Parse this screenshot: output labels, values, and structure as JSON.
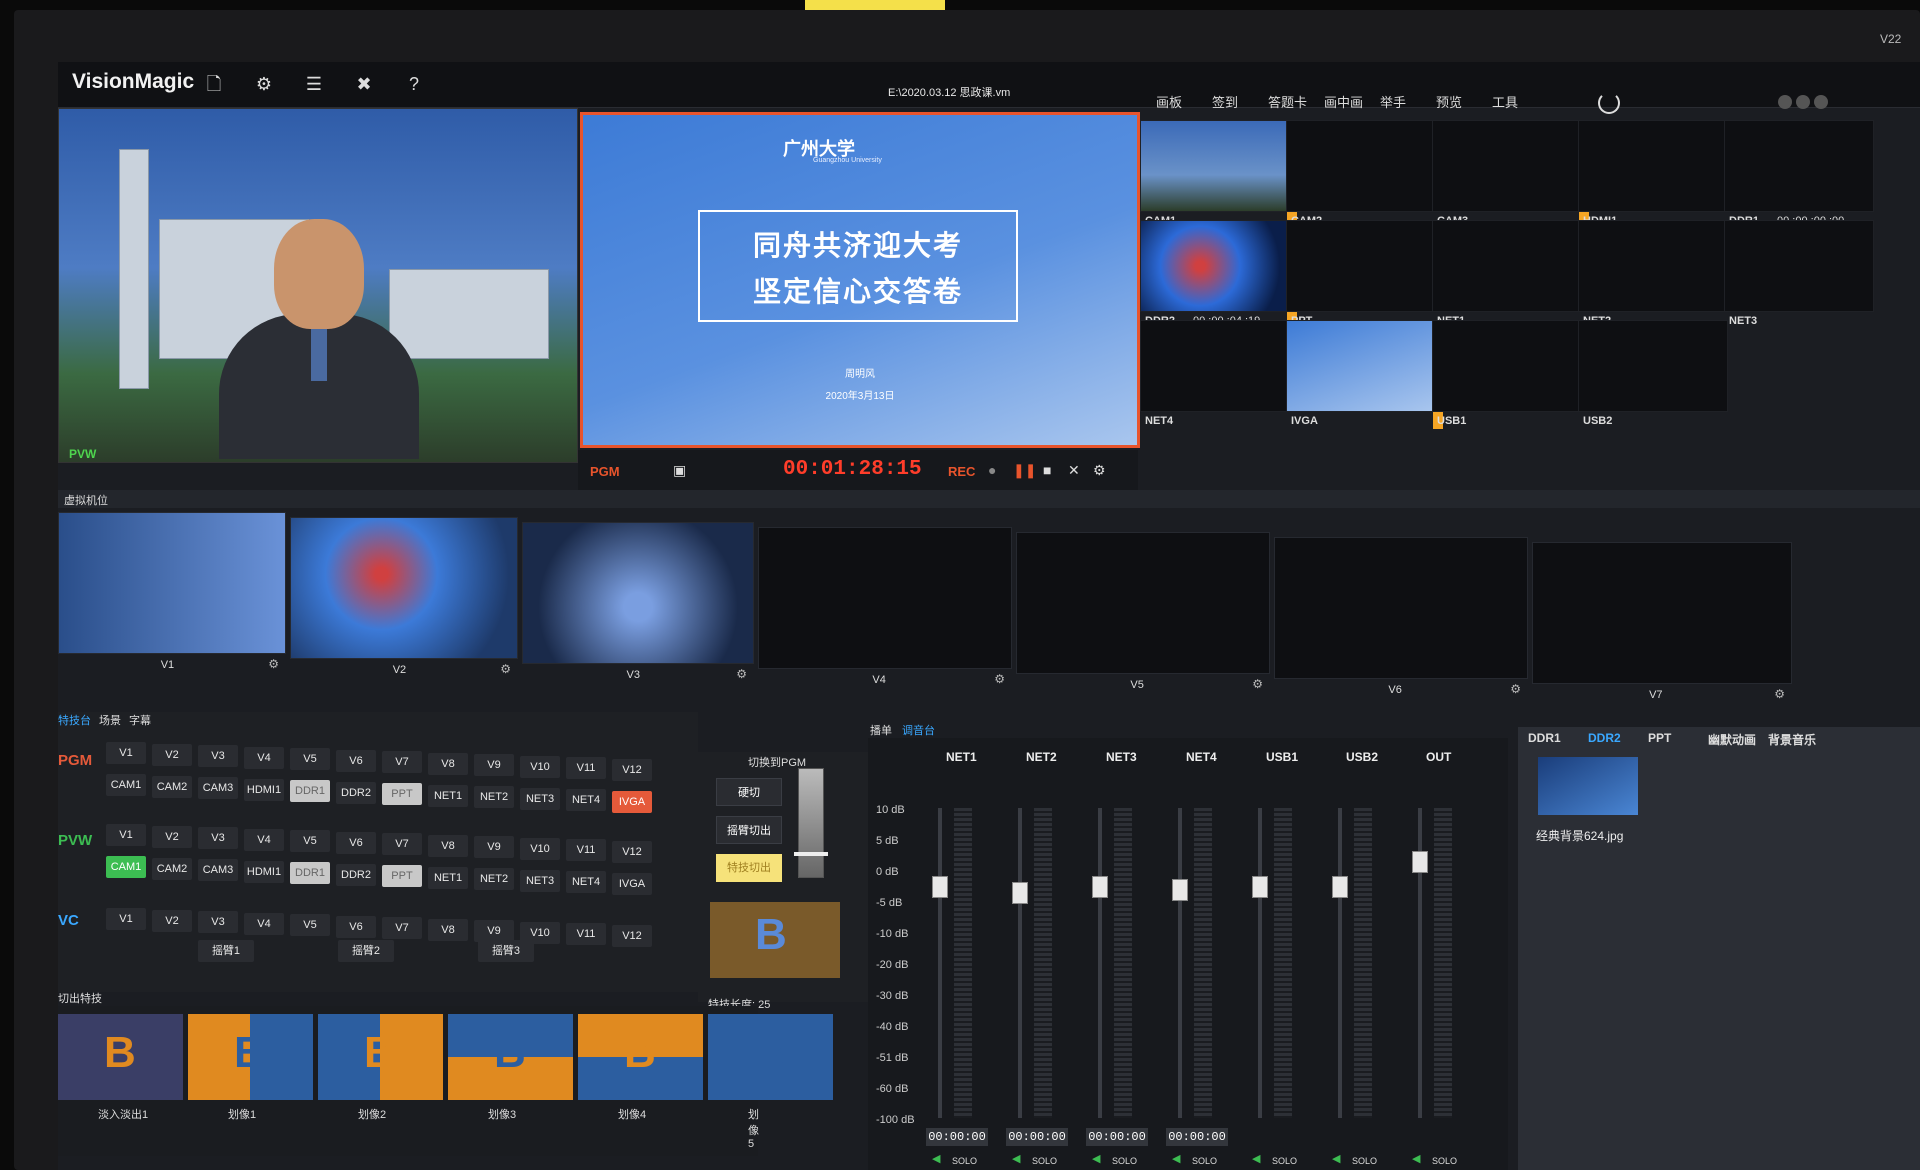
{
  "app": {
    "title": "VisionMagic",
    "filename": "E:\\2020.03.12 思政课.vm",
    "version": "V22"
  },
  "menu": [
    "画板",
    "签到",
    "答题卡",
    "画中画",
    "举手",
    "预览",
    "工具"
  ],
  "pvw_monitor": {
    "label": "PVW"
  },
  "pgm_monitor": {
    "label": "PGM",
    "timer": "00:01:28:15",
    "rec_label": "REC",
    "slide": {
      "university": "广州大学",
      "university_en": "Guangzhou University",
      "line1": "同舟共济迎大考",
      "line2": "坚定信心交答卷",
      "presenter": "周明风",
      "date": "2020年3月13日"
    }
  },
  "sources": [
    {
      "name": "CAM1",
      "active": true
    },
    {
      "name": "CAM2"
    },
    {
      "name": "CAM3",
      "active": true
    },
    {
      "name": "HDMI1"
    },
    {
      "name": "DDR1",
      "timecode": "00 :00 :00 :00"
    },
    {
      "name": "DDR2",
      "timecode": "00 :00 :04 :19",
      "active": true
    },
    {
      "name": "PPT"
    },
    {
      "name": "NET1"
    },
    {
      "name": "NET2"
    },
    {
      "name": "NET3"
    },
    {
      "name": "NET4"
    },
    {
      "name": "IVGA",
      "active": true
    },
    {
      "name": "USB1"
    },
    {
      "name": "USB2"
    }
  ],
  "virtual_bar": "虚拟机位",
  "virtual_views": [
    "V1",
    "V2",
    "V3",
    "V4",
    "V5",
    "V6",
    "V7"
  ],
  "switcher": {
    "tabs": [
      "特技台",
      "场景",
      "字幕"
    ],
    "pgm_label": "PGM",
    "pvw_label": "PVW",
    "vc_label": "VC",
    "v_buttons": [
      "V1",
      "V2",
      "V3",
      "V4",
      "V5",
      "V6",
      "V7",
      "V8",
      "V9",
      "V10",
      "V11",
      "V12"
    ],
    "src_buttons": [
      "CAM1",
      "CAM2",
      "CAM3",
      "HDMI1",
      "DDR1",
      "DDR2",
      "PPT",
      "NET1",
      "NET2",
      "NET3",
      "NET4",
      "IVGA"
    ],
    "rockers": [
      "摇臂1",
      "摇臂2",
      "摇臂3"
    ],
    "switch_to_pgm": "切换到PGM",
    "cut": "硬切",
    "rocker_out": "摇臂切出",
    "effect_out": "特技切出",
    "effect_length_label": "特技长度:",
    "effect_length": "25",
    "transitions_title": "切出特技",
    "transitions": [
      "淡入淡出1",
      "划像1",
      "划像2",
      "划像3",
      "划像4",
      "划像5"
    ],
    "ab_glyph": "B"
  },
  "audio": {
    "tabs": [
      "播单",
      "调音台"
    ],
    "channels": [
      {
        "name": "NET1",
        "level": 0.22,
        "tc": "00:00:00"
      },
      {
        "name": "NET2",
        "level": 0.24,
        "tc": "00:00:00"
      },
      {
        "name": "NET3",
        "level": 0.22,
        "tc": "00:00:00"
      },
      {
        "name": "NET4",
        "level": 0.23,
        "tc": "00:00:00"
      },
      {
        "name": "USB1",
        "level": 0.22,
        "tc": ""
      },
      {
        "name": "USB2",
        "level": 0.22,
        "tc": ""
      },
      {
        "name": "OUT",
        "level": 0.14,
        "tc": ""
      }
    ],
    "db_scale": [
      "10 dB",
      "5 dB",
      "0 dB",
      "-5 dB",
      "-10 dB",
      "-20 dB",
      "-30 dB",
      "-40 dB",
      "-51 dB",
      "-60 dB",
      "-100 dB"
    ],
    "solo": "SOLO"
  },
  "media": {
    "tabs": [
      "DDR1",
      "DDR2",
      "PPT",
      "幽默动画",
      "背景音乐"
    ],
    "item_name": "经典背景624.jpg"
  },
  "colors": {
    "accent": "#3aa8ff",
    "pgm_red": "#e55a3a",
    "pvw_green": "#3cbd52",
    "timer": "#ff3d2a",
    "active_marker": "#f5a524"
  }
}
